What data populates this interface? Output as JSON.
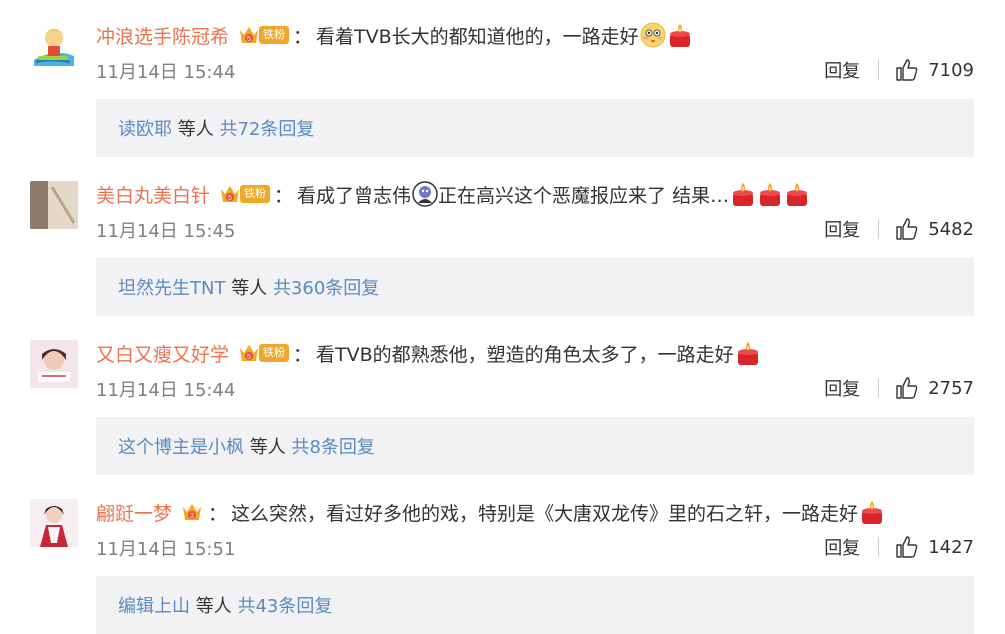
{
  "comments": [
    {
      "username": "冲浪选手陈冠希",
      "badge_level": "5",
      "fan_label": "铁粉",
      "colon": "：",
      "text": "看着TVB长大的都知道他的，一路走好",
      "emojis": [
        "flushed-face-emoji",
        "candle-emoji"
      ],
      "time": "11月14日 15:44",
      "reply_label": "回复",
      "likes": "7109",
      "reply_users": "读欧耶",
      "reply_mid": "等人",
      "reply_count": "共72条回复"
    },
    {
      "username": "美白丸美白针",
      "badge_level": "5",
      "fan_label": "铁粉",
      "colon": "：",
      "text": "看成了曾志伟",
      "text2": "正在高兴这个恶魔报应来了 结果…",
      "emojis": [
        "candle-emoji",
        "candle-emoji",
        "candle-emoji"
      ],
      "time": "11月14日 15:45",
      "reply_label": "回复",
      "likes": "5482",
      "reply_users": "坦然先生TNT",
      "reply_mid": "等人",
      "reply_count": "共360条回复"
    },
    {
      "username": "又白又瘦又好学",
      "badge_level": "5",
      "fan_label": "铁粉",
      "colon": "：",
      "text": "看TVB的都熟悉他，塑造的角色太多了，一路走好",
      "emojis": [
        "candle-emoji"
      ],
      "time": "11月14日 15:44",
      "reply_label": "回复",
      "likes": "2757",
      "reply_users": "这个博主是小枫",
      "reply_mid": "等人",
      "reply_count": "共8条回复"
    },
    {
      "username": "翩跹一梦",
      "badge_level": "3",
      "colon": "：",
      "text": "这么突然，看过好多他的戏，特别是《大唐双龙传》里的石之轩，一路走好",
      "emojis": [
        "candle-emoji"
      ],
      "time": "11月14日 15:51",
      "reply_label": "回复",
      "likes": "1427",
      "reply_users": "编辑上山",
      "reply_mid": "等人",
      "reply_count": "共43条回复"
    }
  ],
  "colors": {
    "username": "#eb7350",
    "link": "#5b8ac2",
    "reply_bg": "#f2f2f5",
    "meta": "#808080"
  }
}
